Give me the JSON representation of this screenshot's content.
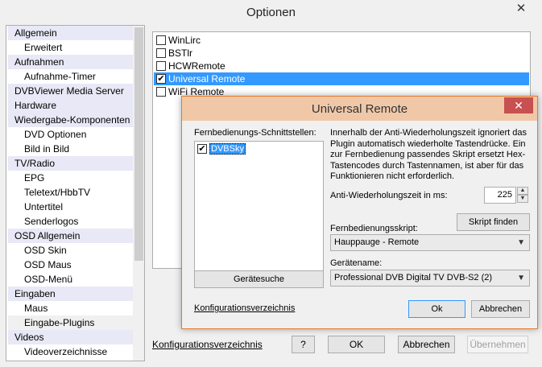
{
  "window": {
    "title": "Optionen",
    "close_glyph": "✕"
  },
  "tree": {
    "items": [
      {
        "label": "Allgemein",
        "level": "cat"
      },
      {
        "label": "Erweitert",
        "level": "sub"
      },
      {
        "label": "Aufnahmen",
        "level": "cat"
      },
      {
        "label": "Aufnahme-Timer",
        "level": "sub"
      },
      {
        "label": "DVBViewer Media Server",
        "level": "cat"
      },
      {
        "label": "Hardware",
        "level": "cat"
      },
      {
        "label": "Wiedergabe-Komponenten",
        "level": "cat"
      },
      {
        "label": "DVD Optionen",
        "level": "sub"
      },
      {
        "label": "Bild in Bild",
        "level": "sub"
      },
      {
        "label": "TV/Radio",
        "level": "cat"
      },
      {
        "label": "EPG",
        "level": "sub"
      },
      {
        "label": "Teletext/HbbTV",
        "level": "sub"
      },
      {
        "label": "Untertitel",
        "level": "sub"
      },
      {
        "label": "Senderlogos",
        "level": "sub"
      },
      {
        "label": "OSD Allgemein",
        "level": "cat"
      },
      {
        "label": "OSD Skin",
        "level": "sub"
      },
      {
        "label": "OSD Maus",
        "level": "sub"
      },
      {
        "label": "OSD-Menü",
        "level": "sub"
      },
      {
        "label": "Eingaben",
        "level": "cat"
      },
      {
        "label": "Maus",
        "level": "sub"
      },
      {
        "label": "Eingabe-Plugins",
        "level": "sub",
        "selected": true
      },
      {
        "label": "Videos",
        "level": "cat"
      },
      {
        "label": "Videoverzeichnisse",
        "level": "sub"
      }
    ]
  },
  "plugins": {
    "items": [
      {
        "label": "WinLirc",
        "checked": false
      },
      {
        "label": "BSTlr",
        "checked": false
      },
      {
        "label": "HCWRemote",
        "checked": false
      },
      {
        "label": "Universal Remote",
        "checked": true,
        "selected": true
      },
      {
        "label": "WiFi Remote",
        "checked": false
      }
    ],
    "check_glyph": "✔"
  },
  "footer": {
    "config_link": "Konfigurationsverzeichnis",
    "help_button": "?",
    "ok_button": "OK",
    "cancel_button": "Abbrechen",
    "apply_button": "Übernehmen"
  },
  "dialog": {
    "title": "Universal Remote",
    "close_glyph": "✕",
    "interfaces_label": "Fernbedienungs-Schnittstellen:",
    "interfaces": [
      {
        "label": "DVBSky",
        "checked": true
      }
    ],
    "description": "Innerhalb der Anti-Wiederholungszeit ignoriert das Plugin automatisch wiederholte Tastendrücke. Ein zur Fernbedienung passendes Skript ersetzt Hex-Tastencodes durch Tastennamen, ist aber für das Funktionieren nicht erforderlich.",
    "anti_repeat_label": "Anti-Wiederholungszeit in ms:",
    "anti_repeat_value": "225",
    "spin_up": "▲",
    "spin_down": "▼",
    "find_script_button": "Skript finden",
    "script_label": "Fernbedienungsskript:",
    "script_value": "Hauppauge - Remote",
    "device_label": "Gerätename:",
    "device_value": "Professional DVB Digital TV DVB-S2 (2)",
    "dropdown_glyph": "▼",
    "device_search_button": "Gerätesuche",
    "config_link": "Konfigurationsverzeichnis",
    "ok_button": "Ok",
    "cancel_button": "Abbrechen"
  }
}
